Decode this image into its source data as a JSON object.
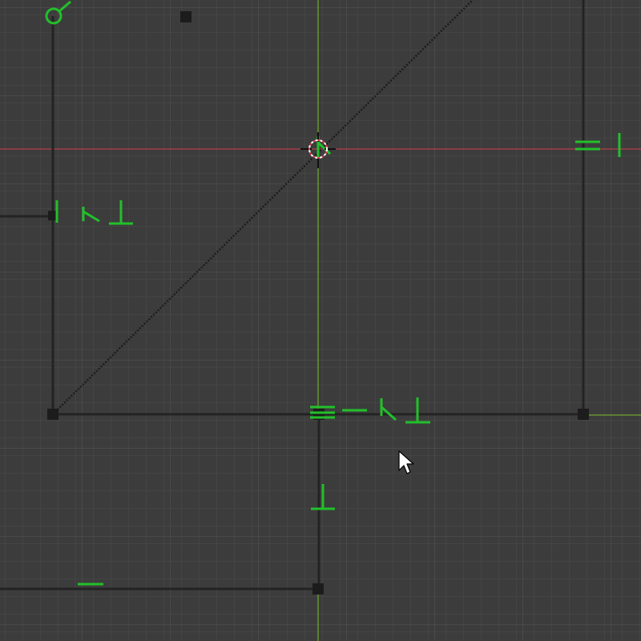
{
  "app": {
    "name": "sketch-canvas",
    "mode": "2d-sketch"
  },
  "colors": {
    "background": "#3c3c3c",
    "grid_minor": "#4a4a4a",
    "grid_major": "#555555",
    "geometry": "#222222",
    "construction": "#222222",
    "constraint": "#22c02a",
    "axis_x": "#d23c4b",
    "axis_y": "#7bbf2a",
    "cursor_fill": "#ffffff",
    "cursor_stroke": "#000000",
    "origin_marker": "#ffffff"
  },
  "icons": {
    "cursor": "arrow-cursor-icon",
    "origin": "origin-crosshair-icon",
    "constraint_coincident": "coincident-icon",
    "constraint_horizontal": "horizontal-icon",
    "constraint_vertical": "vertical-icon",
    "constraint_perpendicular": "perpendicular-icon",
    "constraint_equal": "equal-icon",
    "constraint_tangent": "tangent-icon",
    "constraint_midpoint": "midpoint-icon"
  },
  "sketch": {
    "constraint_glyph_count": 14,
    "vertex_count": 6,
    "has_construction_diagonal": true
  }
}
